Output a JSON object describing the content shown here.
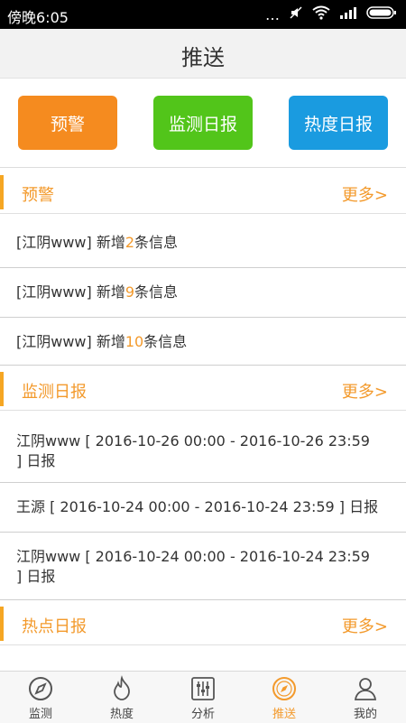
{
  "status_bar": {
    "time": "傍晚6:05",
    "icons": [
      "more-dots-icon",
      "mute-icon",
      "wifi-icon",
      "signal-icon",
      "battery-icon"
    ]
  },
  "header": {
    "title": "推送"
  },
  "buttons": {
    "warning": "预警",
    "monitor_daily": "监测日报",
    "heat_daily": "热度日报"
  },
  "sections": {
    "warning": {
      "title": "预警",
      "more": "更多>",
      "items": [
        {
          "prefix": "[江阴www] 新增",
          "count": "2",
          "suffix": "条信息"
        },
        {
          "prefix": "[江阴www] 新增",
          "count": "9",
          "suffix": "条信息"
        },
        {
          "prefix": "[江阴www] 新增",
          "count": "10",
          "suffix": "条信息"
        }
      ]
    },
    "monitor": {
      "title": "监测日报",
      "more": "更多>",
      "items": [
        {
          "text": "江阴www [ 2016-10-26 00:00 - 2016-10-26 23:59 ] 日报"
        },
        {
          "text": "王源 [ 2016-10-24 00:00 - 2016-10-24 23:59 ] 日报"
        },
        {
          "text": "江阴www [ 2016-10-24 00:00 - 2016-10-24 23:59 ] 日报"
        }
      ]
    },
    "heat": {
      "title": "热点日报",
      "more": "更多>"
    }
  },
  "tabbar": {
    "tabs": [
      {
        "label": "监测",
        "icon": "compass-icon"
      },
      {
        "label": "热度",
        "icon": "flame-icon"
      },
      {
        "label": "分析",
        "icon": "sliders-icon"
      },
      {
        "label": "推送",
        "icon": "push-compass-icon",
        "active": true
      },
      {
        "label": "我的",
        "icon": "user-icon"
      }
    ]
  },
  "colors": {
    "accent": "#f39a2c",
    "warning_button": "#f58b1f",
    "monitor_button": "#52c51a",
    "heat_button": "#1a9be0"
  }
}
